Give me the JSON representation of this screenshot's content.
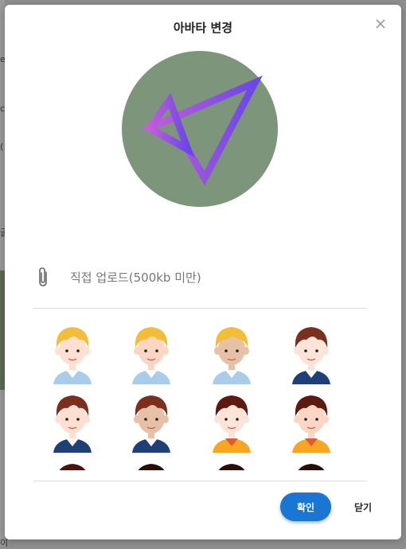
{
  "dialog": {
    "title": "아바타 변경",
    "close_icon": "close-icon"
  },
  "preview": {
    "background_color": "#7d957a",
    "icon": "paper-plane-icon",
    "gradient_start": "#c25fd6",
    "gradient_end": "#6b47e8"
  },
  "upload": {
    "icon": "paperclip-icon",
    "label": "직접 업로드(500kb 미만)"
  },
  "avatar_options": [
    {
      "hair": "#f2bd3a",
      "skin": "#fde0d2",
      "shirt": "#a9cde8",
      "collar": "#ffffff"
    },
    {
      "hair": "#f2bd3a",
      "skin": "#fbd6c4",
      "shirt": "#a9cde8",
      "collar": "#ffffff"
    },
    {
      "hair": "#f2bd3a",
      "skin": "#e7c1a6",
      "shirt": "#a9cde8",
      "collar": "#ffffff"
    },
    {
      "hair": "#7b2f1f",
      "skin": "#fde3d8",
      "shirt": "#1f3f78",
      "collar": "#ffffff"
    },
    {
      "hair": "#7b2f1f",
      "skin": "#fde0d2",
      "shirt": "#1f3f78",
      "collar": "#ffffff"
    },
    {
      "hair": "#7b2f1f",
      "skin": "#e7c1a6",
      "shirt": "#1f3f78",
      "collar": "#ffffff"
    },
    {
      "hair": "#5e1a10",
      "skin": "#fde3d8",
      "shirt": "#f6a623",
      "collar": "#e8582a"
    },
    {
      "hair": "#5e1a10",
      "skin": "#fbd6c4",
      "shirt": "#f6a623",
      "collar": "#e8582a"
    },
    {
      "hair": "#4a140c",
      "skin": "#fde0d2",
      "shirt": "#cccccc",
      "collar": "#ffffff"
    },
    {
      "hair": "#2a0d07",
      "skin": "#fbd6c4",
      "shirt": "#cccccc",
      "collar": "#ffffff"
    },
    {
      "hair": "#2a0d07",
      "skin": "#e7c1a6",
      "shirt": "#cccccc",
      "collar": "#ffffff"
    },
    {
      "hair": "#2a0d07",
      "skin": "#fde3d8",
      "shirt": "#cccccc",
      "collar": "#ffffff"
    }
  ],
  "actions": {
    "confirm_label": "확인",
    "close_label": "닫기",
    "confirm_color": "#1976d2"
  },
  "background_fragments": [
    "e",
    "c",
    "(",
    "글",
    "이"
  ]
}
